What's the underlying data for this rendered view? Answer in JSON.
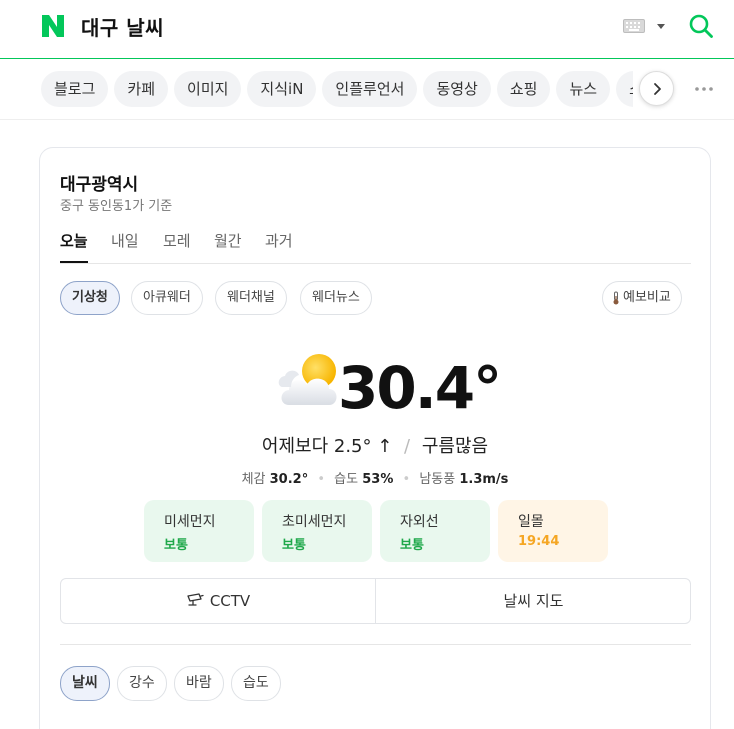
{
  "header": {
    "query": "대구 날씨",
    "brand_color": "#03c75a",
    "logo_letter": "N"
  },
  "categories": [
    "블로그",
    "카페",
    "이미지",
    "지식iN",
    "인플루언서",
    "동영상",
    "쇼핑",
    "뉴스",
    "쇼"
  ],
  "weather": {
    "location": "대구광역시",
    "sub_location": "중구 동인동1가 기준",
    "day_tabs": [
      "오늘",
      "내일",
      "모레",
      "월간",
      "과거"
    ],
    "sources": [
      "기상청",
      "아큐웨더",
      "웨더채널",
      "웨더뉴스"
    ],
    "compare_label": "예보비교",
    "temperature": "30.4°",
    "compare_text": "어제보다",
    "compare_value": "2.5° ↑",
    "condition": "구름많음",
    "feels_label": "체감",
    "feels_value": "30.2°",
    "humidity_label": "습도",
    "humidity_value": "53%",
    "wind_label": "남동풍",
    "wind_value": "1.3m/s",
    "stats": [
      {
        "label": "미세먼지",
        "value": "보통"
      },
      {
        "label": "초미세먼지",
        "value": "보통"
      },
      {
        "label": "자외선",
        "value": "보통"
      },
      {
        "label": "일몰",
        "value": "19:44"
      }
    ],
    "cctv_label": "CCTV",
    "map_label": "날씨 지도",
    "chart_tabs": [
      "날씨",
      "강수",
      "바람",
      "습도"
    ]
  }
}
